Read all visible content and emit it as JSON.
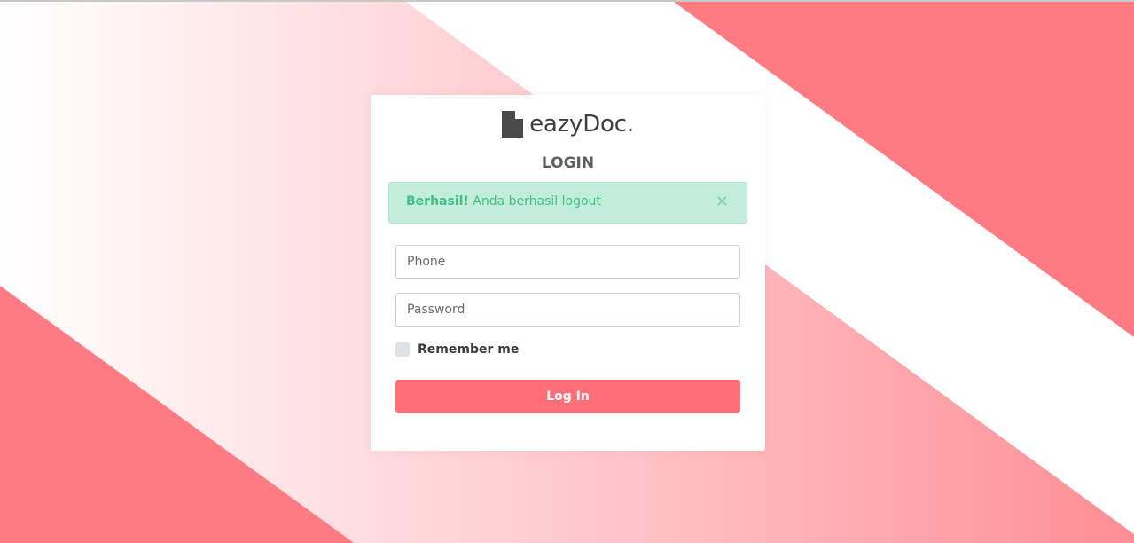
{
  "brand": {
    "name": "eazyDoc.",
    "icon": "file-icon"
  },
  "login": {
    "title": "LOGIN"
  },
  "alert": {
    "strong": "Berhasil!",
    "message": " Anda berhasil logout",
    "close": "×"
  },
  "form": {
    "phone_placeholder": "Phone",
    "password_placeholder": "Password",
    "remember_label": "Remember me",
    "submit_label": "Log In"
  },
  "colors": {
    "accent": "#ff6f78",
    "background_pink": "#ff7b83",
    "alert_bg": "#c3eddb",
    "alert_text": "#3fbf86"
  }
}
